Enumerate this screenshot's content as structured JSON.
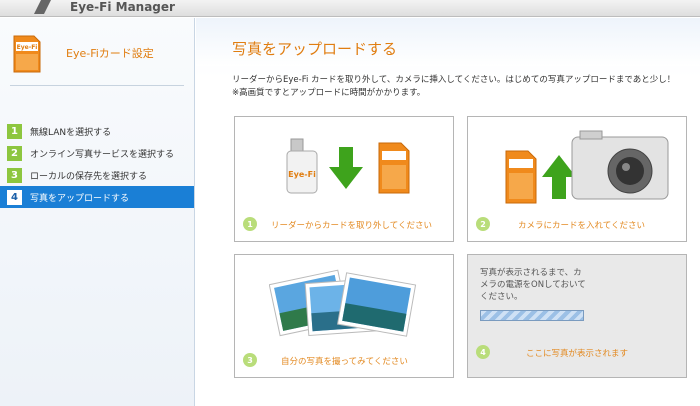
{
  "app": {
    "title": "Eye-Fi Manager"
  },
  "sidebar": {
    "card_label": "Eye-Fi",
    "settings_label": "Eye-Fiカード設定",
    "steps": [
      {
        "num": "1",
        "label": "無線LANを選択する"
      },
      {
        "num": "2",
        "label": "オンライン写真サービスを選択する"
      },
      {
        "num": "3",
        "label": "ローカルの保存先を選択する"
      },
      {
        "num": "4",
        "label": "写真をアップロードする"
      }
    ],
    "active_step": 4
  },
  "main": {
    "title": "写真をアップロードする",
    "description_line1": "リーダーからEye-Fi カードを取り外して、カメラに挿入してください。はじめての写真アップロードまであと少し！",
    "description_line2": "※高画質ですとアップロードに時間がかかります。",
    "panels": [
      {
        "num": "1",
        "caption": "リーダーからカードを取り外してください"
      },
      {
        "num": "2",
        "caption": "カメラにカードを入れてください"
      },
      {
        "num": "3",
        "caption": "自分の写真を撮ってみてください"
      },
      {
        "num": "4",
        "caption": "ここに写真が表示されます",
        "message_line1": "写真が表示されるまで、カ",
        "message_line2": "メラの電源をONしておいて",
        "message_line3": "ください。"
      }
    ]
  },
  "colors": {
    "accent_orange": "#e07d10",
    "active_blue": "#1a7fd6",
    "step_green": "#8dc63f",
    "arrow_green": "#3ea31c"
  },
  "icons": [
    "eye-fi-logo-icon",
    "sd-card-icon",
    "card-reader-icon",
    "down-arrow-icon",
    "camera-icon",
    "up-arrow-icon",
    "photos-icon"
  ]
}
